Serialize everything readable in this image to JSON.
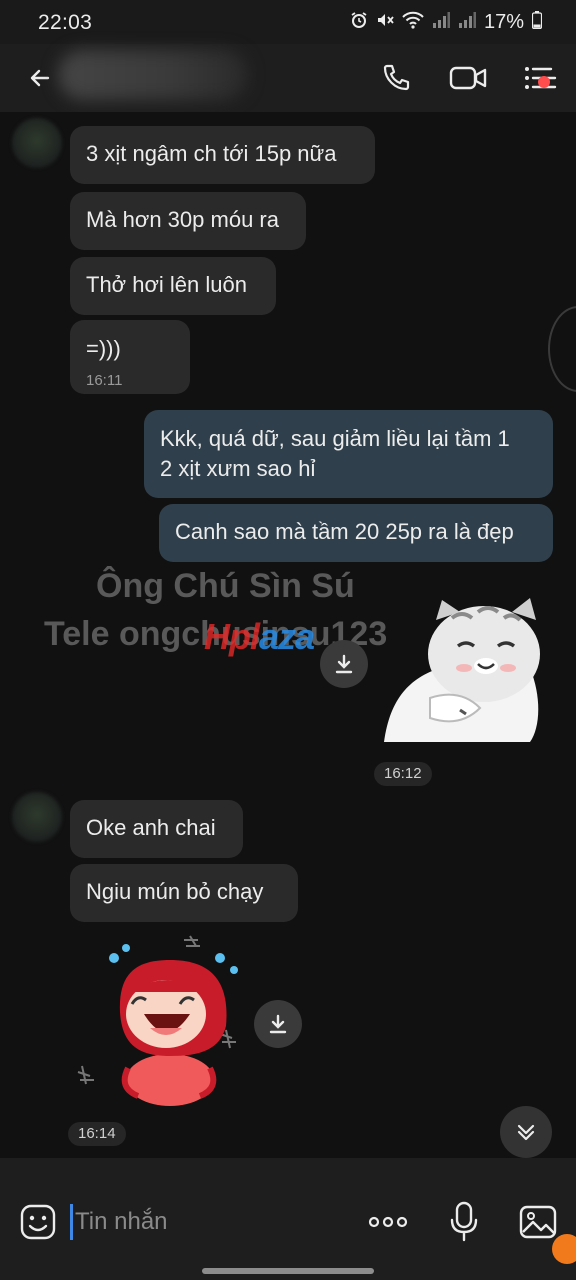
{
  "status_bar": {
    "time": "22:03",
    "battery": "17%"
  },
  "header": {
    "contact_name": ""
  },
  "messages": [
    {
      "text": "3 xịt ngâm ch tới 15p nữa"
    },
    {
      "text": "Mà hơn 30p móu ra"
    },
    {
      "text": "Thở hơi lên luôn"
    },
    {
      "text": "=)))",
      "time": "16:11"
    },
    {
      "line1": "Kkk, quá dữ, sau giảm liều lại tầm 1",
      "line2": "2 xịt xưm sao hỉ"
    },
    {
      "text": "Canh sao mà tầm 20 25p ra là đẹp"
    },
    {
      "time": "16:12"
    },
    {
      "text": "Oke anh chai"
    },
    {
      "text": "Ngiu mún bỏ chạy"
    },
    {
      "time": "16:14"
    }
  ],
  "watermark": {
    "line1": "Ông Chú Sìn Sú",
    "line2": "Tele ongchusinsu123",
    "logo_red": "Hpl",
    "logo_blue": "aza"
  },
  "composer": {
    "placeholder": "Tin nhắn"
  },
  "colors": {
    "background": "#111111",
    "incoming_bubble": "#2a2a2a",
    "outgoing_bubble": "#2f3f4b",
    "cursor": "#3f88e6",
    "badge": "#ff4d4d"
  }
}
